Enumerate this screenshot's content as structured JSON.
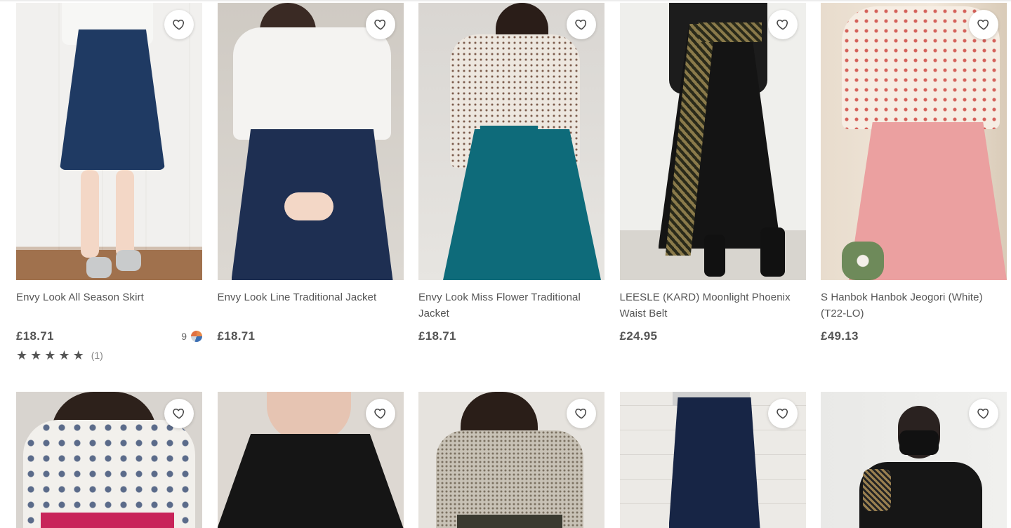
{
  "products": [
    {
      "name": "Envy Look All Season Skirt",
      "price": "£18.71",
      "color_count": "9",
      "rating_count": "(1)",
      "stars": 5
    },
    {
      "name": "Envy Look Line Traditional Jacket",
      "price": "£18.71"
    },
    {
      "name": "Envy Look Miss Flower Traditional Jacket",
      "price": "£18.71"
    },
    {
      "name": "LEESLE (KARD) Moonlight Phoenix Waist Belt",
      "price": "£24.95"
    },
    {
      "name": "S Hanbok Hanbok Jeogori (White) (T22-LO)",
      "price": "£49.13"
    }
  ],
  "icons": {
    "wishlist": "heart-icon",
    "star": "star-icon",
    "color_swatch": "color-swatch-icon"
  },
  "colors": {
    "text": "#555555",
    "price": "#555555",
    "star": "#555555"
  }
}
